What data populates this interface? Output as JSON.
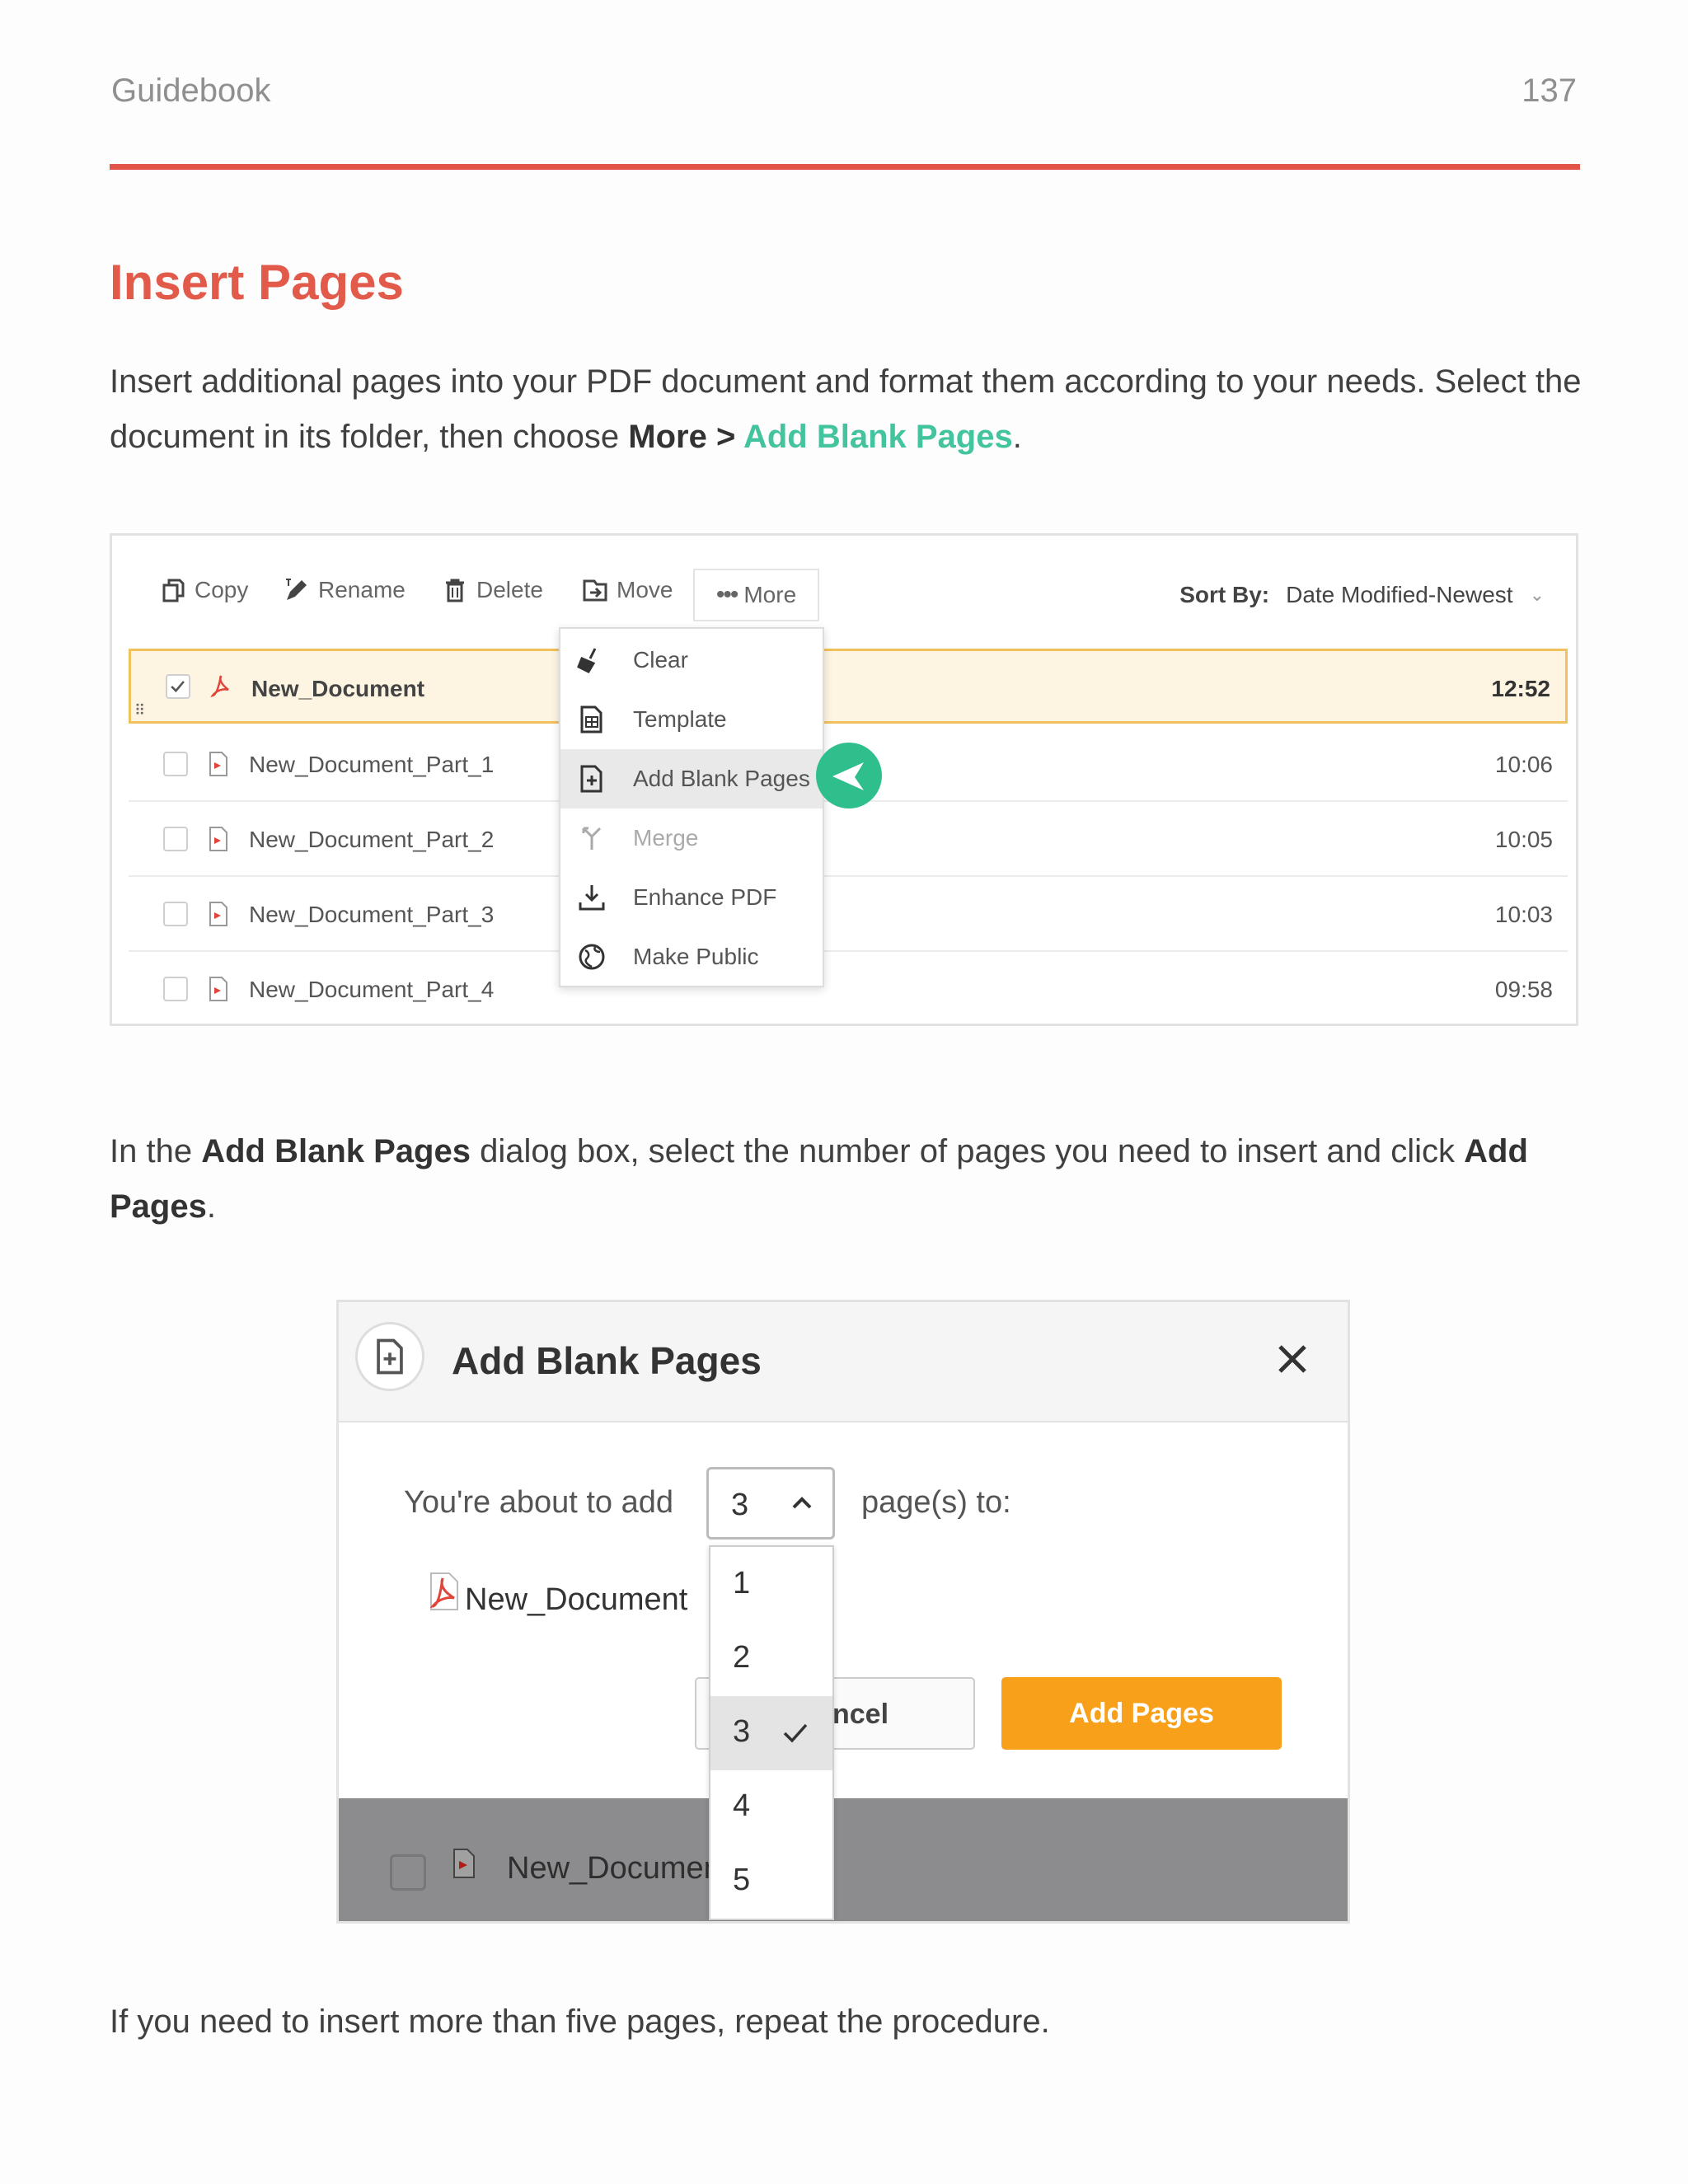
{
  "header": {
    "left": "Guidebook",
    "page_number": "137"
  },
  "section_title": "Insert Pages",
  "intro": {
    "text1": "Insert additional pages into your PDF document and format them according to your needs. Select the document in its folder,  then choose ",
    "bold": "More",
    "sep": " > ",
    "accent": "Add Blank Pages",
    "end": "."
  },
  "toolbar": {
    "copy": "Copy",
    "rename": "Rename",
    "delete": "Delete",
    "move": "Move",
    "more": "More",
    "sort_label": "Sort By:",
    "sort_value": "Date Modified-Newest"
  },
  "files": [
    {
      "name": "New_Document",
      "time": "12:52"
    },
    {
      "name": "New_Document_Part_1",
      "time": "10:06"
    },
    {
      "name": "New_Document_Part_2",
      "time": "10:05"
    },
    {
      "name": "New_Document_Part_3",
      "time": "10:03"
    },
    {
      "name": "New_Document_Part_4",
      "time": "09:58"
    }
  ],
  "more_menu": [
    "Clear",
    "Template",
    "Add Blank Pages",
    "Merge",
    "Enhance PDF",
    "Make Public"
  ],
  "para2": {
    "t1": "In the ",
    "b1": "Add Blank Pages",
    "t2": " dialog box, select the number of pages you need to insert and click ",
    "b2": "Add Pages",
    "t3": "."
  },
  "dialog": {
    "title": "Add Blank Pages",
    "about": "You're about to add",
    "selected": "3",
    "pages_to": "page(s) to:",
    "document": "New_Document",
    "cancel_partial": "ncel",
    "add_button": "Add Pages",
    "options": [
      "1",
      "2",
      "3",
      "4",
      "5"
    ],
    "bg_row_name": "New_Documen"
  },
  "closing": "If you need to insert more than five pages, repeat the procedure."
}
